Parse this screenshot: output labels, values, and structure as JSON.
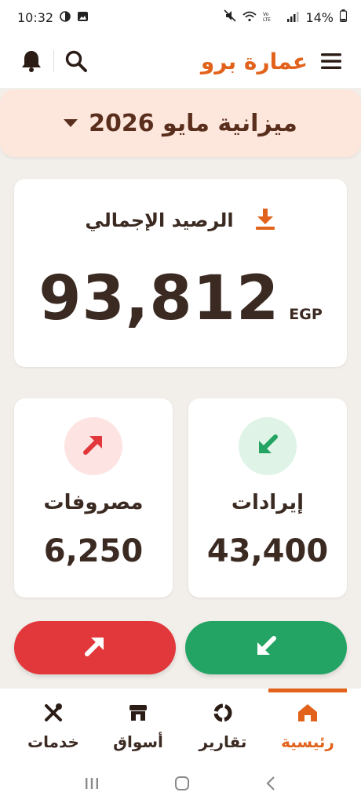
{
  "status_bar": {
    "time": "10:32",
    "battery": "14%"
  },
  "header": {
    "brand": "عمارة برو",
    "icons": [
      "menu-icon",
      "search-icon",
      "bell-icon"
    ]
  },
  "budget": {
    "title": "ميزانية مايو 2026"
  },
  "balance": {
    "label": "الرصيد الإجمالي",
    "value": "93,812",
    "currency": "EGP"
  },
  "stats": {
    "income": {
      "label": "إيرادات",
      "value": "43,400",
      "color": "#23a464"
    },
    "expense": {
      "label": "مصروفات",
      "value": "6,250",
      "color": "#e2383b"
    }
  },
  "bottom_nav": {
    "items": [
      {
        "label": "رئيسية",
        "icon": "home-icon",
        "active": true
      },
      {
        "label": "تقارير",
        "icon": "reports-icon"
      },
      {
        "label": "أسواق",
        "icon": "store-icon"
      },
      {
        "label": "خدمات",
        "icon": "tools-icon"
      }
    ]
  },
  "colors": {
    "accent": "#e2621b",
    "income": "#23a464",
    "expense": "#e2383b",
    "banner": "#fde6dc"
  }
}
